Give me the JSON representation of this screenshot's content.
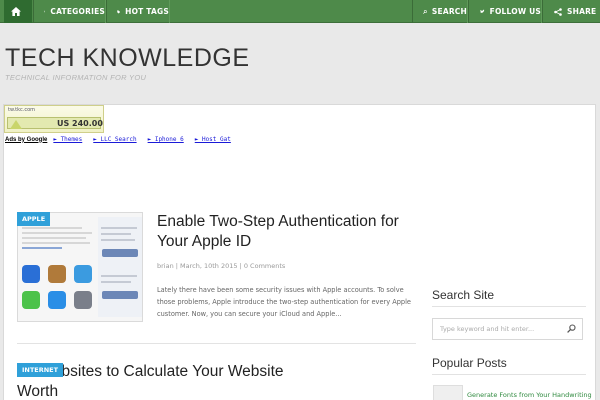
{
  "nav": {
    "categories": "CATEGORIES",
    "hot_tags": "HOT TAGS",
    "search": "SEARCH",
    "follow_us": "FOLLOW US",
    "share": "SHARE"
  },
  "site": {
    "title": "TECH KNOWLEDGE",
    "tagline": "TECHNICAL INFORMATION FOR YOU"
  },
  "ad": {
    "site": "tw.tkc.com",
    "price": "US 240.00",
    "ads_by": "Ads by Google",
    "links": [
      "► Themes",
      "► LLC Search",
      "► Iphone 6",
      "► Host Gat"
    ]
  },
  "posts": [
    {
      "category": "APPLE",
      "title": "Enable Two-Step Authentication for Your Apple ID",
      "meta": "brian | March, 10th 2015 | 0 Comments",
      "excerpt": "Lately there have been some security issues with Apple accounts. To solve those problems, Apple introduce the two-step authentication for every Apple customer. Now, you can secure your iCloud and Apple..."
    },
    {
      "category": "INTERNET",
      "title": "10 Websites to Calculate Your Website Worth"
    }
  ],
  "sidebar": {
    "search_title": "Search Site",
    "search_placeholder": "Type keyword and hit enter...",
    "popular_title": "Popular Posts",
    "popular_link": "Generate Fonts from Your Handwriting"
  },
  "colors": {
    "nav_green": "#4e8a4a",
    "badge_blue": "#2fa0d9",
    "link_green": "#2f8a3f"
  },
  "icons": [
    "home-icon",
    "menu-icon",
    "tag-icon",
    "search-icon",
    "bird-icon",
    "share-icon"
  ]
}
